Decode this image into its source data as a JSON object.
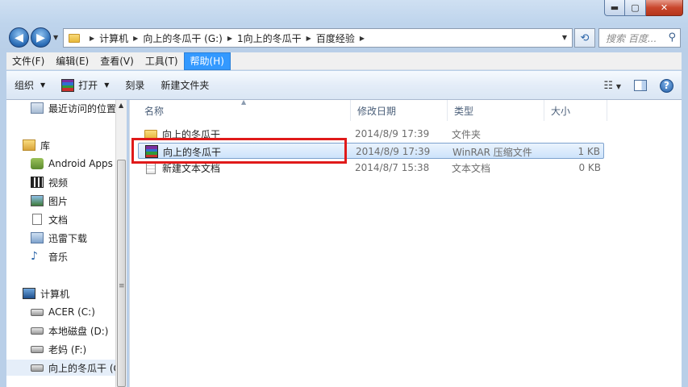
{
  "window": {
    "controls": {
      "minimize": "▬",
      "maximize": "▢",
      "close": "✕"
    }
  },
  "nav": {
    "back_icon": "arrow-left-icon",
    "forward_icon": "arrow-right-icon",
    "breadcrumbs": [
      "计算机",
      "向上的冬瓜干 (G:)",
      "1向上的冬瓜干",
      "百度经验"
    ],
    "search_placeholder": "搜索 百度..."
  },
  "menubar": {
    "items": [
      "文件(F)",
      "编辑(E)",
      "查看(V)",
      "工具(T)",
      "帮助(H)"
    ],
    "active_index": 4
  },
  "commandbar": {
    "organize": "组织",
    "open": "打开",
    "burn": "刻录",
    "new_folder": "新建文件夹"
  },
  "sidebar": {
    "items": [
      {
        "label": "最近访问的位置",
        "icon": "recent-places-icon"
      },
      {
        "label": "库",
        "icon": "library-icon"
      },
      {
        "label": "Android Apps",
        "icon": "android-icon"
      },
      {
        "label": "视频",
        "icon": "video-icon"
      },
      {
        "label": "图片",
        "icon": "picture-icon"
      },
      {
        "label": "文档",
        "icon": "document-icon"
      },
      {
        "label": "迅雷下载",
        "icon": "download-icon"
      },
      {
        "label": "音乐",
        "icon": "music-icon"
      },
      {
        "label": "计算机",
        "icon": "computer-icon"
      },
      {
        "label": "ACER (C:)",
        "icon": "drive-icon"
      },
      {
        "label": "本地磁盘 (D:)",
        "icon": "drive-icon"
      },
      {
        "label": "老妈 (F:)",
        "icon": "drive-icon"
      },
      {
        "label": "向上的冬瓜干 (G:)",
        "icon": "drive-icon"
      }
    ]
  },
  "filelist": {
    "columns": [
      "名称",
      "修改日期",
      "类型",
      "大小"
    ],
    "rows": [
      {
        "name": "向上的冬瓜干",
        "date": "2014/8/9 17:39",
        "type": "文件夹",
        "size": "",
        "icon": "folder-icon"
      },
      {
        "name": "向上的冬瓜干",
        "date": "2014/8/9 17:39",
        "type": "WinRAR 压缩文件",
        "size": "1 KB",
        "icon": "winrar-icon"
      },
      {
        "name": "新建文本文档",
        "date": "2014/8/7 15:38",
        "type": "文本文档",
        "size": "0 KB",
        "icon": "text-file-icon"
      }
    ],
    "selected_index": 1
  },
  "colors": {
    "highlight": "#e01a1a",
    "menu_active": "#3399ff"
  }
}
